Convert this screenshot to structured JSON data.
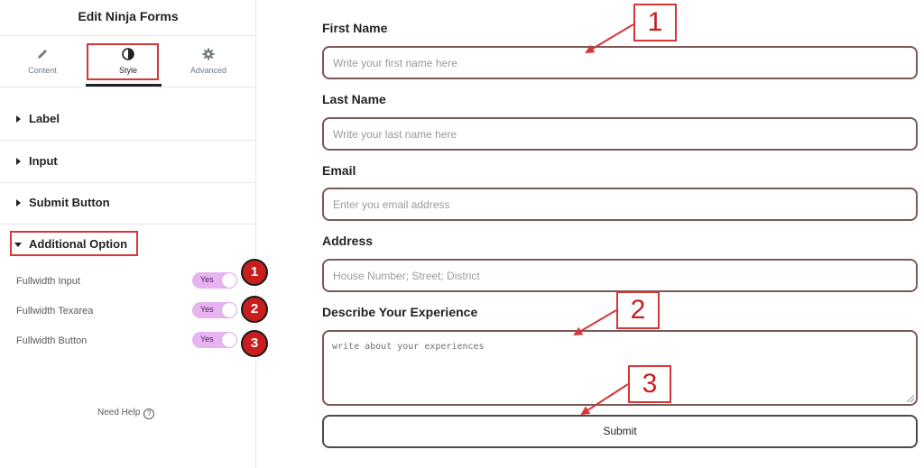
{
  "panel": {
    "title": "Edit Ninja Forms",
    "tabs": [
      {
        "label": "Content",
        "icon": "pencil-icon"
      },
      {
        "label": "Style",
        "icon": "half-circle-icon"
      },
      {
        "label": "Advanced",
        "icon": "gear-icon"
      }
    ],
    "sections": [
      {
        "label": "Label"
      },
      {
        "label": "Input"
      },
      {
        "label": "Submit Button"
      },
      {
        "label": "Additional Option",
        "expanded": true
      }
    ],
    "controls": [
      {
        "label": "Fullwidth Input",
        "value": "Yes",
        "badge": "1"
      },
      {
        "label": "Fullwidth Texarea",
        "value": "Yes",
        "badge": "2"
      },
      {
        "label": "Fullwidth Button",
        "value": "Yes",
        "badge": "3"
      }
    ],
    "help": "Need Help",
    "help_icon": "?"
  },
  "form": {
    "fields": [
      {
        "label": "First Name",
        "placeholder": "Write your first name here"
      },
      {
        "label": "Last Name",
        "placeholder": "Write your  last name here"
      },
      {
        "label": "Email",
        "placeholder": "Enter you email address"
      },
      {
        "label": "Address",
        "placeholder": "House Number; Street; District"
      }
    ],
    "textarea": {
      "label": "Describe Your Experience",
      "placeholder": "write about your experiences"
    },
    "submit_label": "Submit"
  },
  "annotations": {
    "box1": "1",
    "box2": "2",
    "box3": "3"
  },
  "colors": {
    "accent": "#d63638",
    "toggle": "#e7b3f0",
    "input_border": "#7b5858"
  }
}
